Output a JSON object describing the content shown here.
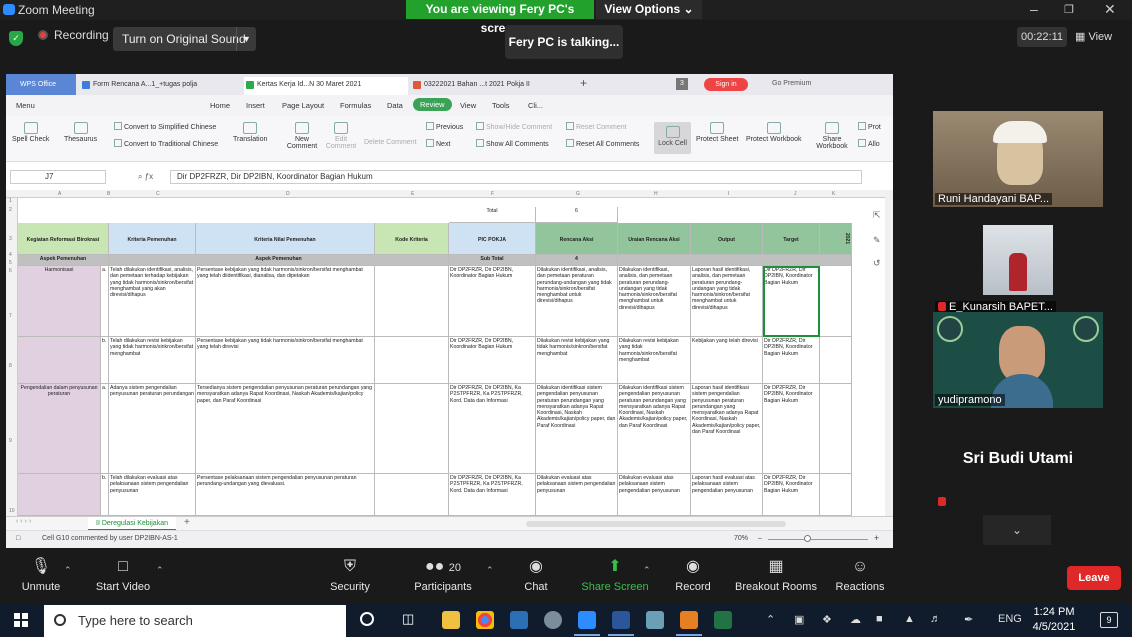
{
  "zoom": {
    "window_title": "Zoom Meeting",
    "viewing_banner": "You are viewing Fery PC's screen",
    "view_options": "View Options",
    "recording_label": "Recording",
    "original_sound": "Turn on Original Sound",
    "talking": "Fery PC is talking...",
    "timer": "00:22:11",
    "view_label": "View",
    "leave_label": "Leave"
  },
  "wps": {
    "tabs": [
      {
        "label": "WPS Office"
      },
      {
        "label": "Form Rencana A...1_+tugas polja"
      },
      {
        "label": "Kertas Kerja Id...N 30 Maret 2021"
      },
      {
        "label": "03222021 Bahan ...t 2021 Pokja II"
      }
    ],
    "tab_count": "3",
    "sign_in": "Sign in",
    "go_premium": "Go Premium",
    "menu": [
      "Menu",
      "Home",
      "Insert",
      "Page Layout",
      "Formulas",
      "Data",
      "Review",
      "View",
      "Tools",
      "Cli..."
    ],
    "ribbon": {
      "spell_check": "Spell Check",
      "thesaurus": "Thesaurus",
      "to_simplified": "Convert to Simplified Chinese",
      "to_traditional": "Convert to Traditional Chinese",
      "translation": "Translation",
      "new_comment": "New Comment",
      "edit_comment": "Edit Comment",
      "delete_comment": "Delete Comment",
      "previous": "Previous",
      "next": "Next",
      "show_hide_comment": "Show/Hide Comment",
      "show_all_comments": "Show All Comments",
      "reset_comment": "Reset Comment",
      "reset_all_comments": "Reset All Comments",
      "lock_cell": "Lock Cell",
      "protect_sheet": "Protect Sheet",
      "protect_workbook": "Protect Workbook",
      "share_workbook": "Share Workbook",
      "prot": "Prot",
      "allo": "Allo"
    },
    "name_box": "J7",
    "formula": "Dir DP2FRZR, Dir DP2IBN, Koordinator Bagian Hukum",
    "col_letters": [
      "A",
      "B",
      "C",
      "D",
      "E",
      "F",
      "G",
      "H",
      "I",
      "J",
      "K"
    ],
    "row_numbers": [
      "1",
      "2",
      "3",
      "4",
      "5",
      "6",
      "7",
      "8",
      "9",
      "10"
    ],
    "sheet": {
      "total_label": "Total",
      "total_value": "6",
      "headers": {
        "kegiatan": "Kegiatan Reformasi Birokrasi",
        "kriteria_pemenuhan": "Kriteria Pemenuhan",
        "kriteria_nilai": "Kriteria Nilai Pemenuhan",
        "kode": "Kode Kriteria",
        "pic": "PIC POKJA",
        "rencana": "Rencana Aksi",
        "uraian": "Uraian Rencana Aksi",
        "output": "Output",
        "target": "Target",
        "year": "2021"
      },
      "aspek_pemenuhan": "Aspek Pemenuhan",
      "aspek_pemenuhan2": "Aspek Pemenuhan",
      "sub_total": "Sub Total",
      "sub_total_value": "4",
      "rows": [
        {
          "kegiatan": "Harmonisasi",
          "letter": "a.",
          "kriteria": "Telah dilakukan identifikasi, analisis, dan pemetaan terhadap kebijakan yang tidak harmonis/sinkron/bersifat menghambat yang akan direvisi/dihapus",
          "nilai": "Persentase kebijakan yang tidak harmonis/sinkron/bersifat menghambat yang telah diidentifikasi, dianalisa, dan dipetakan",
          "pic": "Dir DP2FRZR, Dir DP2IBN, Koordinator Bagian Hukum",
          "rencana": "Dilakukan identifikasi, analisis, dan pemetaan peraturan perundang-undangan yang tidak harmonis/sinkron/bersifat menghambat untuk direvisi/dihapus",
          "uraian": "Dilakukan identifikasi, analisis, dan pemetaan peraturan perundang-undangan yang tidak harmonis/sinkron/bersifat menghambat untuk direvisi/dihapus",
          "output": "Laporan hasil identifikasi, analisis, dan pemetaan peraturan perundang-undangan yang tidak harmonis/sinkron/bersifat menghambat untuk direvisi/dihapus",
          "target": "Dir DP2FRZR, Dir DP2IBN, Koordinator Bagian Hukum"
        },
        {
          "kegiatan": "",
          "letter": "b.",
          "kriteria": "Telah dilakukan revisi kebijakan yang tidak harmonis/sinkron/bersifat menghambat",
          "nilai": "Persentase kebijakan yang tidak harmonis/sinkron/bersifat menghambat yang telah direvisi",
          "pic": "Dir DP2FRZR, Dir DP2IBN, Koordinator Bagian Hukum",
          "rencana": "Dilakukan revisi kebijakan yang tidak harmonis/sinkron/bersifat menghambat",
          "uraian": "Dilakukan revisi kebijakan yang tidak harmonis/sinkron/bersifat menghambat",
          "output": "Kebijakan yang telah direvisi",
          "target": "Dir DP2FRZR, Dir DP2IBN, Koordinator Bagian Hukum"
        },
        {
          "kegiatan": "Pengendalian dalam penyusunan peraturan",
          "letter": "a.",
          "kriteria": "Adanya sistem pengendalian penyusunan peraturan perundangan",
          "nilai": "Tersedianya sistem pengendalian penyusunan peraturan perundangan yang mensyaratkan adanya Rapat Koordinasi, Naskah Akademis/kajian/policy paper, dan Paraf Koordinasi",
          "pic": "Dir DP2FRZR, Dir DP2IBN, Ka P2STPFRZR, Ka P2STPFRZR, Kord. Data dan Informasi",
          "rencana": "Dilakukan identifikasi sistem pengendalian penyusunan peraturan perundangan yang mensyaratkan adanya Rapat Koordinasi, Naskah Akademis/kajian/policy paper, dan Paraf Koordinasi",
          "uraian": "Dilakukan identifikasi sistem pengendalian penyusunan peraturan perundangan yang mensyaratkan adanya Rapat Koordinasi, Naskah Akademis/kajian/policy paper, dan Paraf Koordinasi",
          "output": "Laporan hasil identifikasi sistem pengendalian penyusunan peraturan perundangan yang mensyaratkan adanya Rapat Koordinasi, Naskah Akademis/kajian/policy paper, dan Paraf Koordinasi",
          "target": "Dir DP2FRZR, Dir DP2IBN, Koordinator Bagian Hukum"
        },
        {
          "kegiatan": "",
          "letter": "b.",
          "kriteria": "Telah dilakukan evaluasi atas pelaksanaan sistem pengendalian penyusunan",
          "nilai": "Persentase pelaksanaan sistem pengendalian penyusunan peraturan perundang-undangan yang dievaluasi.",
          "pic": "Dir DP2FRZR, Dir DP2IBN, Ka P2STPFRZR, Ka P2STPFRZR, Kord. Data dan Informasi",
          "rencana": "Dilakukan evaluasi atas pelaksanaan sistem pengendalian penyusunan",
          "uraian": "Dilakukan evaluasi atas pelaksanaan sistem pengendalian penyusunan",
          "output": "Laporan hasil evaluasi atas pelaksanaan sistem pengendalian penyusunan",
          "target": "Dir DP2FRZR, Dir DP2IBN, Koordinator Bagian Hukum"
        }
      ]
    },
    "sheet_tab": "II Deregulasi Kebijakan",
    "status_text": "Cell G10 commented by user DP2IBN-AS-1",
    "zoom_level": "70%"
  },
  "participants": [
    {
      "name": "Runi Handayani BAP..."
    },
    {
      "name": "E_Kunarsih BAPET..."
    },
    {
      "name": "yudipramono"
    },
    {
      "name": "Sri Budi Utami"
    }
  ],
  "toolbar": {
    "unmute": "Unmute",
    "start_video": "Start Video",
    "security": "Security",
    "participants": "Participants",
    "participants_count": "20",
    "chat": "Chat",
    "share_screen": "Share Screen",
    "record": "Record",
    "breakout_rooms": "Breakout Rooms",
    "reactions": "Reactions"
  },
  "taskbar": {
    "search_placeholder": "Type here to search",
    "language": "ENG",
    "time": "1:24 PM",
    "date": "4/5/2021",
    "notifications": "9"
  },
  "colors": {
    "zoom_green": "#23a12d",
    "leave_red": "#e02828",
    "wps_review_green": "#3aa357",
    "header_green": "#c8e6b4",
    "header_blue": "#cfe2f3"
  }
}
